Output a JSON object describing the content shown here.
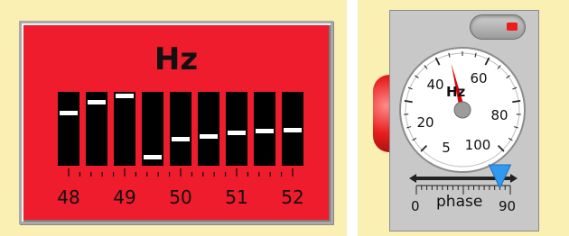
{
  "frequency_meter": {
    "unit": "Hz",
    "scale_labels": [
      "48",
      "49",
      "50",
      "51",
      "52"
    ],
    "reed_mark_levels": [
      0.28,
      0.12,
      0.02,
      0.92,
      0.66,
      0.62,
      0.57,
      0.54,
      0.52
    ],
    "colors": {
      "panel": "#ee1c2c",
      "reed": "#000000",
      "mark": "#ffffff"
    }
  },
  "phase_meter": {
    "toggle": {
      "state": "on",
      "indicator_color": "#ee1c1c"
    },
    "gauge": {
      "unit": "Hz",
      "dial_labels": [
        "5",
        "20",
        "40",
        "60",
        "80",
        "100"
      ],
      "needle_value": 45,
      "needle_color": "#e00000"
    },
    "phase_slider": {
      "label": "phase",
      "min_label": "0",
      "max_label": "90",
      "value": 80,
      "handle_color": "#3399ee"
    },
    "side_knob_color": "#e81d1d"
  }
}
